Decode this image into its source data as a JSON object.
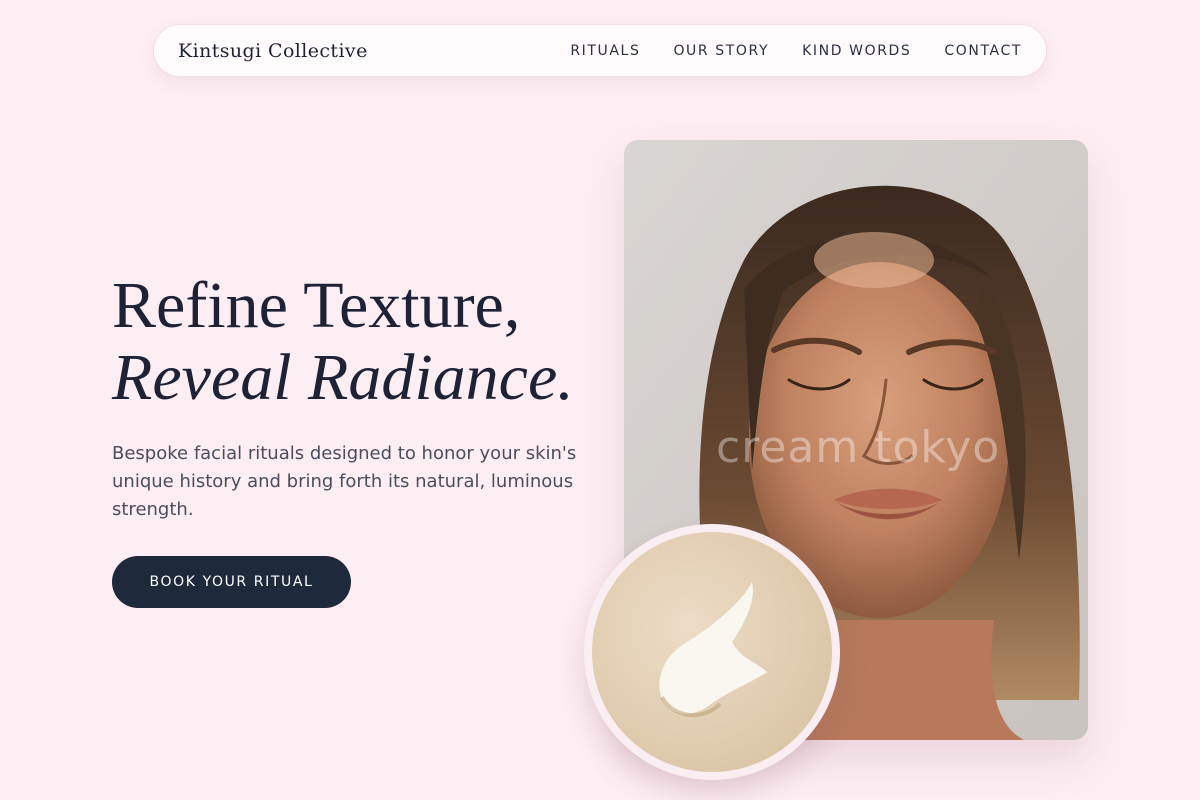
{
  "nav": {
    "brand": "Kintsugi Collective",
    "links": [
      "RITUALS",
      "OUR STORY",
      "KIND WORDS",
      "CONTACT"
    ]
  },
  "hero": {
    "title_line1": "Refine Texture,",
    "title_line2": "Reveal Radiance.",
    "subtitle": "Bespoke facial rituals designed to honor your skin's unique history and bring forth its natural, luminous strength.",
    "cta_label": "BOOK YOUR RITUAL"
  },
  "portrait": {
    "watermark": "cream tokyo"
  },
  "colors": {
    "background": "#fdeef3",
    "navy": "#1e293b",
    "ink": "#1e2235"
  }
}
